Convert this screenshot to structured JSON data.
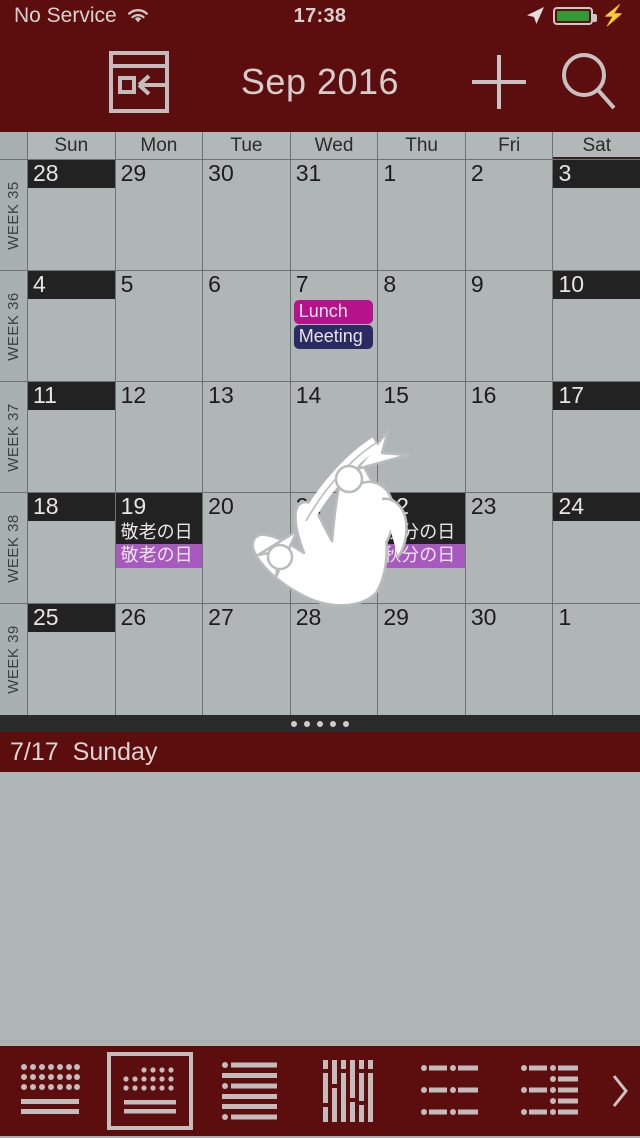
{
  "status_bar": {
    "carrier": "No Service",
    "wifi_icon": "wifi-icon",
    "time": "17:38",
    "location_icon": "location-arrow-icon",
    "battery_icon": "battery-icon",
    "battery_level": 100,
    "charging_icon": "lightning-bolt-icon"
  },
  "nav_bar": {
    "menu_icon": "hamburger-menu-icon",
    "back_to_today_icon": "page-back-icon",
    "title": "Sep 2016",
    "add_icon": "plus-icon",
    "search_icon": "search-icon"
  },
  "calendar": {
    "weekday_headers": [
      "Sun",
      "Mon",
      "Tue",
      "Wed",
      "Thu",
      "Fri",
      "Sat"
    ],
    "weeks": [
      {
        "label": "WEEK 35",
        "days": [
          {
            "num": "28",
            "weekend": true,
            "events": [],
            "holidays": []
          },
          {
            "num": "29",
            "weekend": false,
            "events": [],
            "holidays": []
          },
          {
            "num": "30",
            "weekend": false,
            "events": [],
            "holidays": []
          },
          {
            "num": "31",
            "weekend": false,
            "events": [],
            "holidays": []
          },
          {
            "num": "1",
            "weekend": false,
            "events": [],
            "holidays": []
          },
          {
            "num": "2",
            "weekend": false,
            "events": [],
            "holidays": []
          },
          {
            "num": "3",
            "weekend": true,
            "events": [],
            "holidays": []
          }
        ]
      },
      {
        "label": "WEEK 36",
        "days": [
          {
            "num": "4",
            "weekend": true,
            "events": [],
            "holidays": []
          },
          {
            "num": "5",
            "weekend": false,
            "events": [],
            "holidays": []
          },
          {
            "num": "6",
            "weekend": false,
            "events": [],
            "holidays": []
          },
          {
            "num": "7",
            "weekend": false,
            "events": [
              {
                "title": "Lunch",
                "color": "#b5128c"
              },
              {
                "title": "Meeting",
                "color": "#2b2b63"
              }
            ],
            "holidays": []
          },
          {
            "num": "8",
            "weekend": false,
            "events": [],
            "holidays": []
          },
          {
            "num": "9",
            "weekend": false,
            "events": [],
            "holidays": []
          },
          {
            "num": "10",
            "weekend": true,
            "events": [],
            "holidays": []
          }
        ]
      },
      {
        "label": "WEEK 37",
        "days": [
          {
            "num": "11",
            "weekend": true,
            "events": [],
            "holidays": []
          },
          {
            "num": "12",
            "weekend": false,
            "events": [],
            "holidays": []
          },
          {
            "num": "13",
            "weekend": false,
            "events": [],
            "holidays": []
          },
          {
            "num": "14",
            "weekend": false,
            "events": [],
            "holidays": []
          },
          {
            "num": "15",
            "weekend": false,
            "events": [],
            "holidays": []
          },
          {
            "num": "16",
            "weekend": false,
            "events": [],
            "holidays": []
          },
          {
            "num": "17",
            "weekend": true,
            "events": [],
            "holidays": []
          }
        ]
      },
      {
        "label": "WEEK 38",
        "days": [
          {
            "num": "18",
            "weekend": true,
            "events": [],
            "holidays": []
          },
          {
            "num": "19",
            "weekend": true,
            "events": [],
            "holidays": [
              {
                "text": "敬老の日",
                "style": "dark"
              },
              {
                "text": "敬老の日",
                "style": "violet"
              }
            ]
          },
          {
            "num": "20",
            "weekend": false,
            "events": [],
            "holidays": []
          },
          {
            "num": "21",
            "weekend": false,
            "events": [],
            "holidays": []
          },
          {
            "num": "22",
            "weekend": true,
            "events": [],
            "holidays": [
              {
                "text": "秋分の日",
                "style": "dark"
              },
              {
                "text": "秋分の日",
                "style": "violet"
              }
            ]
          },
          {
            "num": "23",
            "weekend": false,
            "events": [],
            "holidays": []
          },
          {
            "num": "24",
            "weekend": true,
            "events": [],
            "holidays": []
          }
        ]
      },
      {
        "label": "WEEK 39",
        "days": [
          {
            "num": "25",
            "weekend": true,
            "events": [],
            "holidays": []
          },
          {
            "num": "26",
            "weekend": false,
            "events": [],
            "holidays": []
          },
          {
            "num": "27",
            "weekend": false,
            "events": [],
            "holidays": []
          },
          {
            "num": "28",
            "weekend": false,
            "events": [],
            "holidays": []
          },
          {
            "num": "29",
            "weekend": false,
            "events": [],
            "holidays": []
          },
          {
            "num": "30",
            "weekend": false,
            "events": [],
            "holidays": []
          },
          {
            "num": "1",
            "weekend": false,
            "events": [],
            "holidays": []
          }
        ]
      }
    ]
  },
  "gesture": {
    "icon": "pinch-zoom-hand-icon"
  },
  "drag_handle": {
    "icon": "drag-handle-dots-icon",
    "dot_count": 5
  },
  "detail_panel": {
    "date": "7/17",
    "weekday": "Sunday"
  },
  "toolbar": {
    "items": [
      {
        "icon": "month-view-icon",
        "selected": false
      },
      {
        "icon": "month-list-view-icon",
        "selected": true
      },
      {
        "icon": "week-list-view-icon",
        "selected": false
      },
      {
        "icon": "week-columns-view-icon",
        "selected": false
      },
      {
        "icon": "day-list-view-icon",
        "selected": false
      },
      {
        "icon": "agenda-view-icon",
        "selected": false
      }
    ],
    "more_icon": "chevron-right-icon"
  },
  "colors": {
    "chrome": "#5c0e0e",
    "grid_bg": "#b0b6b6",
    "grid_line": "#6d7373",
    "weekend_bar": "#222222",
    "holiday_violet": "#a859c0",
    "event_lunch": "#b5128c",
    "event_meeting": "#2b2b63",
    "icon_light": "#c3bcbc"
  }
}
